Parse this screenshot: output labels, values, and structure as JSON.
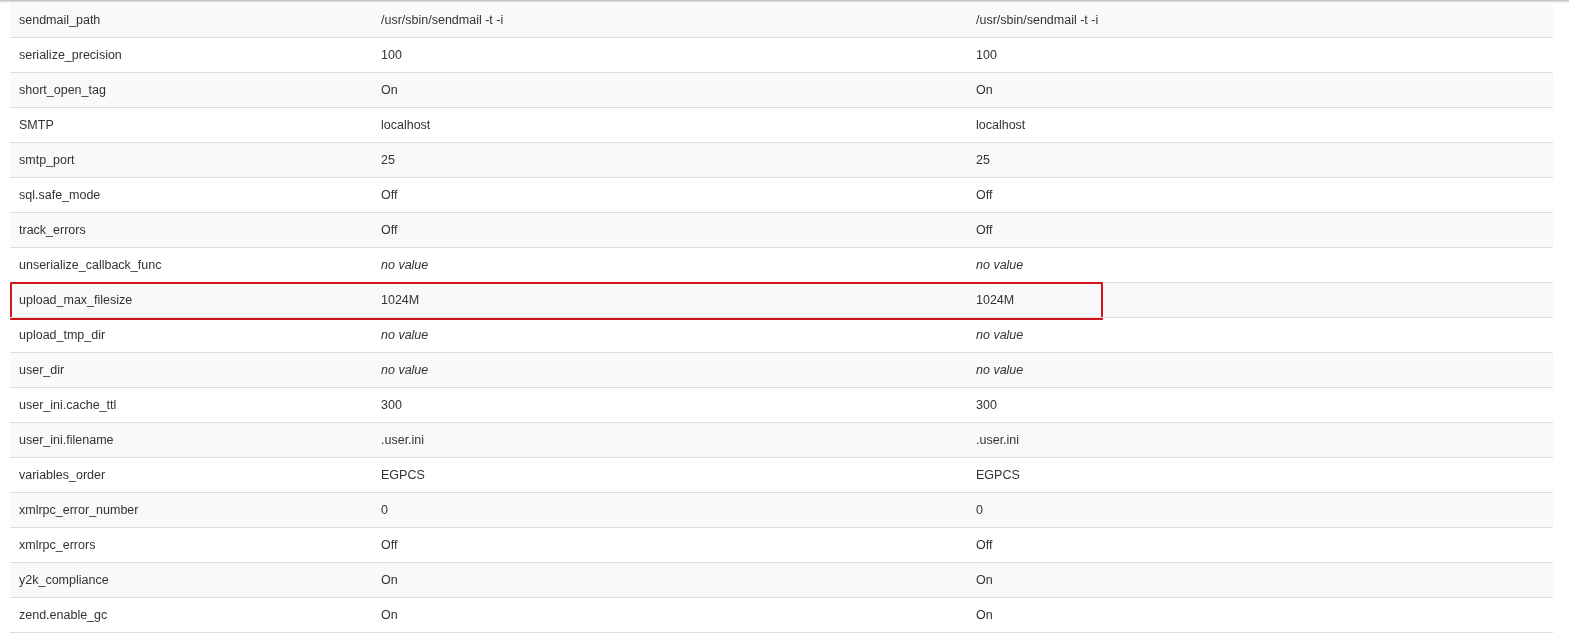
{
  "rows": [
    {
      "directive": "sendmail_path",
      "local": "/usr/sbin/sendmail -t -i",
      "master": "/usr/sbin/sendmail -t -i",
      "italic": false,
      "highlighted": false
    },
    {
      "directive": "serialize_precision",
      "local": "100",
      "master": "100",
      "italic": false,
      "highlighted": false
    },
    {
      "directive": "short_open_tag",
      "local": "On",
      "master": "On",
      "italic": false,
      "highlighted": false
    },
    {
      "directive": "SMTP",
      "local": "localhost",
      "master": "localhost",
      "italic": false,
      "highlighted": false
    },
    {
      "directive": "smtp_port",
      "local": "25",
      "master": "25",
      "italic": false,
      "highlighted": false
    },
    {
      "directive": "sql.safe_mode",
      "local": "Off",
      "master": "Off",
      "italic": false,
      "highlighted": false
    },
    {
      "directive": "track_errors",
      "local": "Off",
      "master": "Off",
      "italic": false,
      "highlighted": false
    },
    {
      "directive": "unserialize_callback_func",
      "local": "no value",
      "master": "no value",
      "italic": true,
      "highlighted": false
    },
    {
      "directive": "upload_max_filesize",
      "local": "1024M",
      "master": "1024M",
      "italic": false,
      "highlighted": true
    },
    {
      "directive": "upload_tmp_dir",
      "local": "no value",
      "master": "no value",
      "italic": true,
      "highlighted": false
    },
    {
      "directive": "user_dir",
      "local": "no value",
      "master": "no value",
      "italic": true,
      "highlighted": false
    },
    {
      "directive": "user_ini.cache_ttl",
      "local": "300",
      "master": "300",
      "italic": false,
      "highlighted": false
    },
    {
      "directive": "user_ini.filename",
      "local": ".user.ini",
      "master": ".user.ini",
      "italic": false,
      "highlighted": false
    },
    {
      "directive": "variables_order",
      "local": "EGPCS",
      "master": "EGPCS",
      "italic": false,
      "highlighted": false
    },
    {
      "directive": "xmlrpc_error_number",
      "local": "0",
      "master": "0",
      "italic": false,
      "highlighted": false
    },
    {
      "directive": "xmlrpc_errors",
      "local": "Off",
      "master": "Off",
      "italic": false,
      "highlighted": false
    },
    {
      "directive": "y2k_compliance",
      "local": "On",
      "master": "On",
      "italic": false,
      "highlighted": false
    },
    {
      "directive": "zend.enable_gc",
      "local": "On",
      "master": "On",
      "italic": false,
      "highlighted": false
    }
  ]
}
